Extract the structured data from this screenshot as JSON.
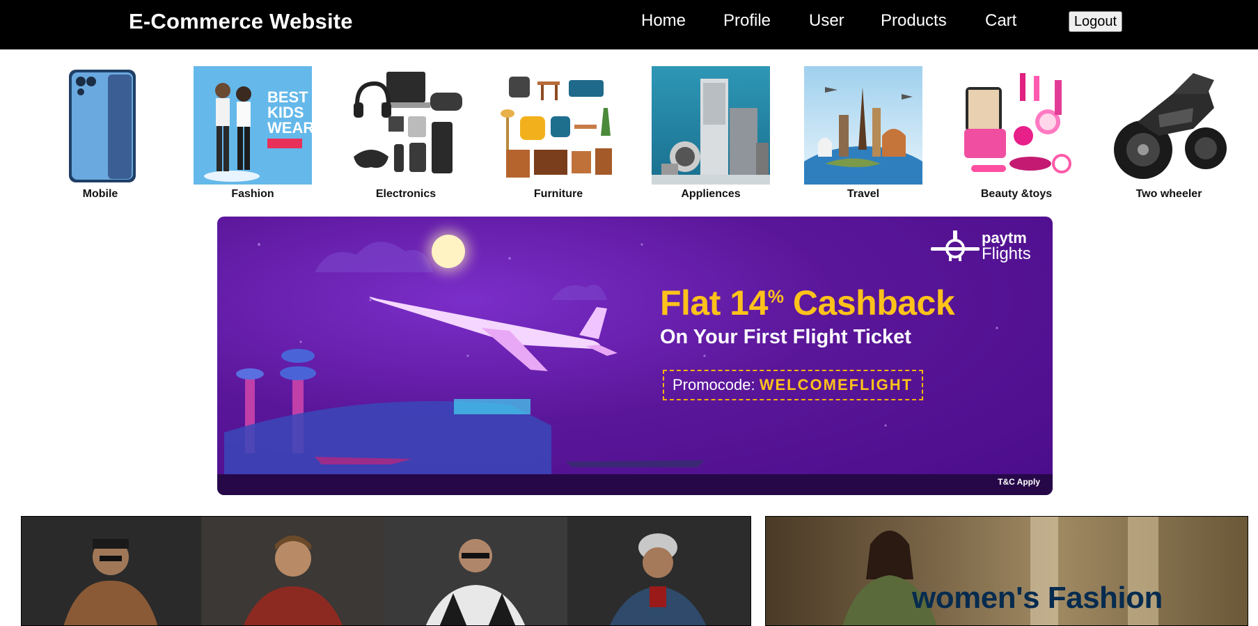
{
  "navbar": {
    "brand": "E-Commerce Website",
    "links": [
      "Home",
      "Profile",
      "User",
      "Products",
      "Cart"
    ],
    "logout_label": "Logout"
  },
  "categories": [
    {
      "label": "Mobile",
      "icon": "smartphone-image"
    },
    {
      "label": "Fashion",
      "icon": "kids-fashion-image"
    },
    {
      "label": "Electronics",
      "icon": "electronics-image"
    },
    {
      "label": "Furniture",
      "icon": "furniture-image"
    },
    {
      "label": "Appliences",
      "icon": "appliances-image"
    },
    {
      "label": "Travel",
      "icon": "travel-image"
    },
    {
      "label": "Beauty &toys",
      "icon": "beauty-toys-image"
    },
    {
      "label": "Two wheeler",
      "icon": "motorcycle-image"
    }
  ],
  "banner": {
    "brand_top": "paytm",
    "brand_bottom": "Flights",
    "headline_prefix": "Flat 14",
    "headline_sup": "%",
    "headline_suffix": " Cashback",
    "subline": "On Your First Flight Ticket",
    "promo_label": "Promocode: ",
    "promo_code": "WELCOMEFLIGHT",
    "terms": "T&C Apply",
    "colors": {
      "accent": "#ffc21a",
      "background": "#5a1699"
    }
  },
  "fashion": {
    "womens_title": "women's Fashion"
  },
  "colors": {
    "navbar": "#000000",
    "page": "#ffffff"
  }
}
